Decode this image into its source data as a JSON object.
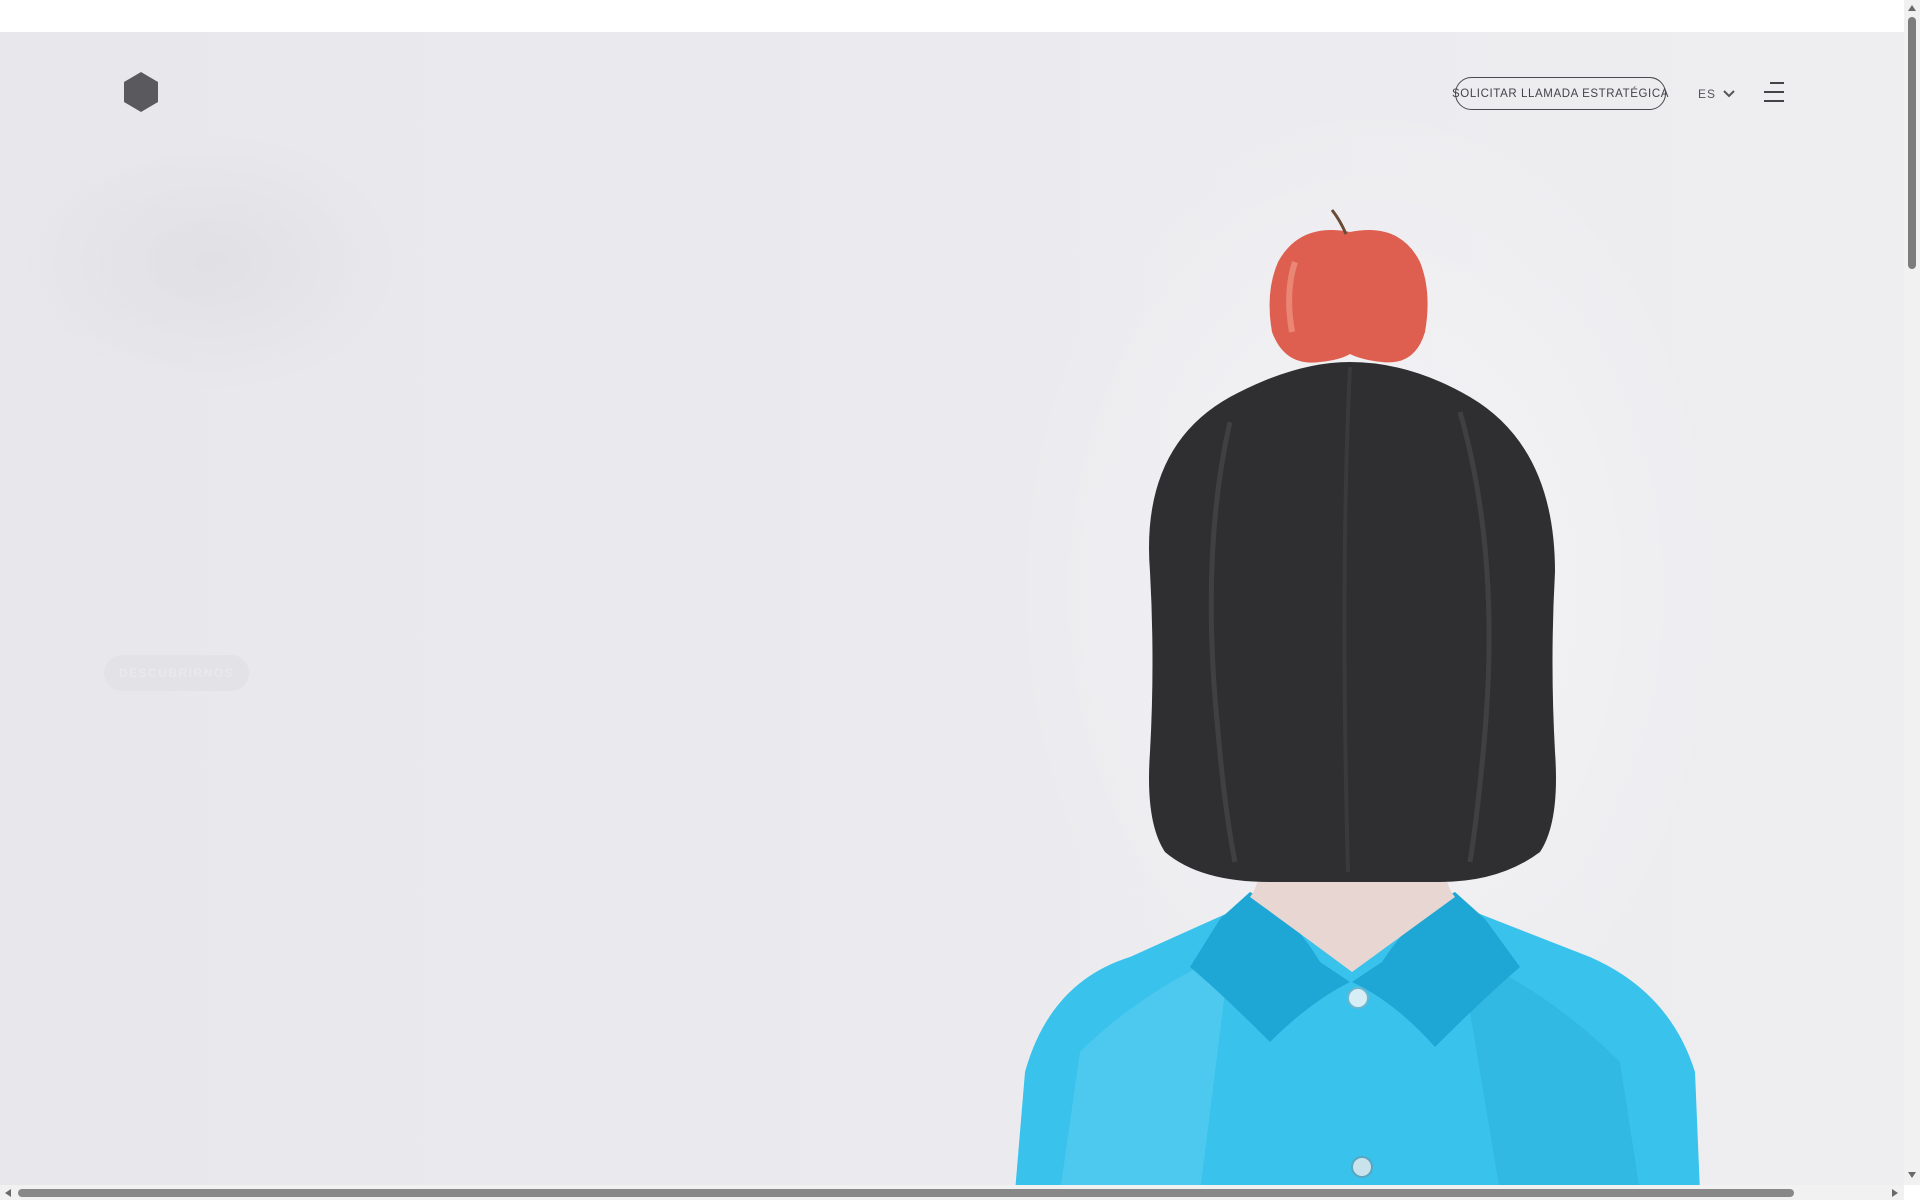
{
  "header": {
    "cta_label": "SOLICITAR LLAMADA ESTRATÉGICA",
    "language": "ES",
    "logo_icon": "hexagon-logo-icon",
    "menu_icon": "hamburger-menu-icon",
    "language_icon": "chevron-down-icon"
  },
  "hero": {
    "button_label": "DESCUBRIRNOS",
    "image": "woman-with-apple-on-head-photo"
  },
  "colors": {
    "background": "#e9e9ed",
    "logo": "#5a5a5e",
    "shirt": "#35c0ea",
    "apple": "#de5f4f",
    "hair": "#2f2f31"
  }
}
